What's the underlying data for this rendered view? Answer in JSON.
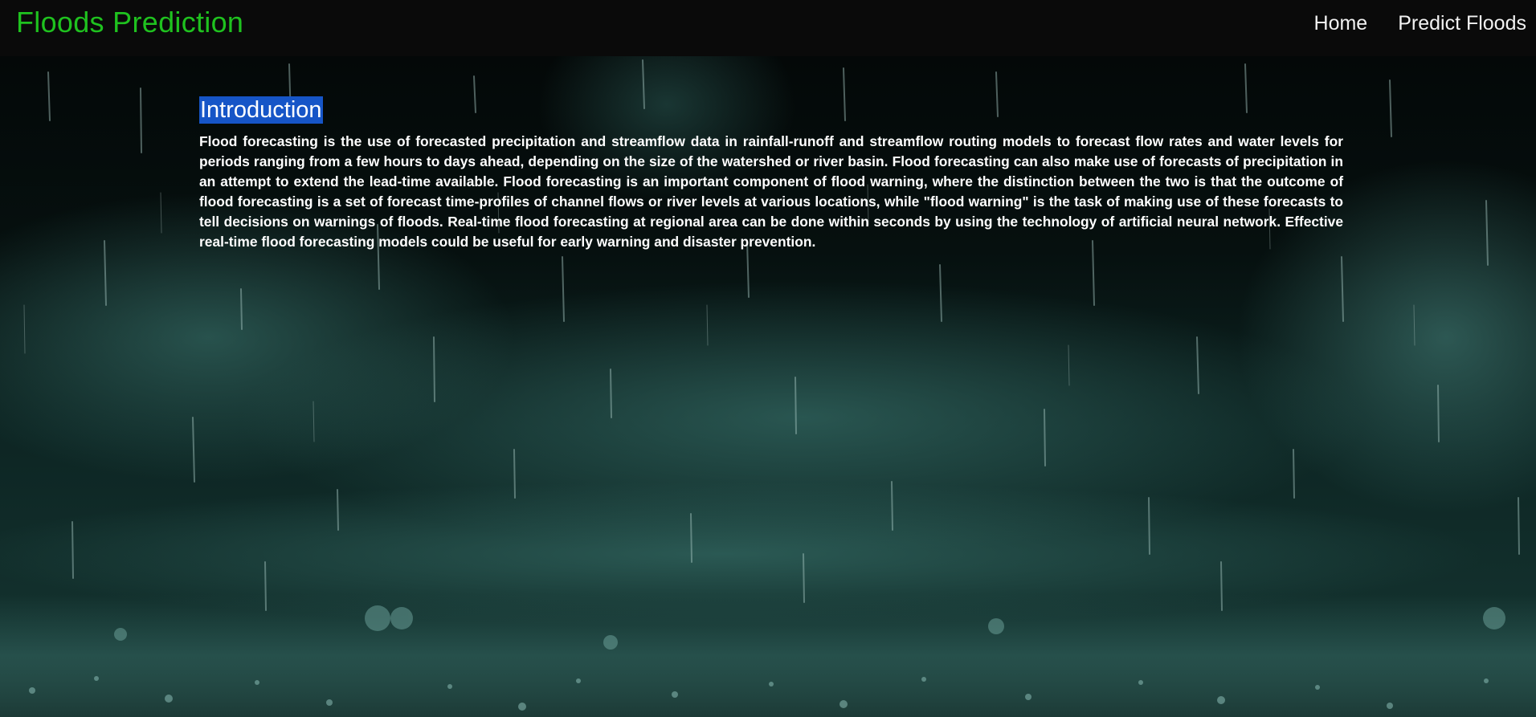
{
  "navbar": {
    "brand": "Floods Prediction",
    "links": [
      {
        "label": "Home"
      },
      {
        "label": "Predict Floods"
      }
    ]
  },
  "intro": {
    "title": "Introduction",
    "text": "Flood forecasting is the use of forecasted precipitation and streamflow data in rainfall-runoff and streamflow routing models to forecast flow rates and water levels for periods ranging from a few hours to days ahead, depending on the size of the watershed or river basin. Flood forecasting can also make use of forecasts of precipitation in an attempt to extend the lead-time available. Flood forecasting is an important component of flood warning, where the distinction between the two is that the outcome of flood forecasting is a set of forecast time-profiles of channel flows or river levels at various locations, while \"flood warning\" is the task of making use of these forecasts to tell decisions on warnings of floods. Real-time flood forecasting at regional area can be done within seconds by using the technology of artificial neural network. Effective real-time flood forecasting models could be useful for early warning and disaster prevention."
  },
  "colors": {
    "brand": "#1fc21f",
    "navbar_bg": "#0a0a0a",
    "title_highlight": "#1655c7",
    "text": "#ffffff",
    "scene_mist": "#2f6660"
  }
}
